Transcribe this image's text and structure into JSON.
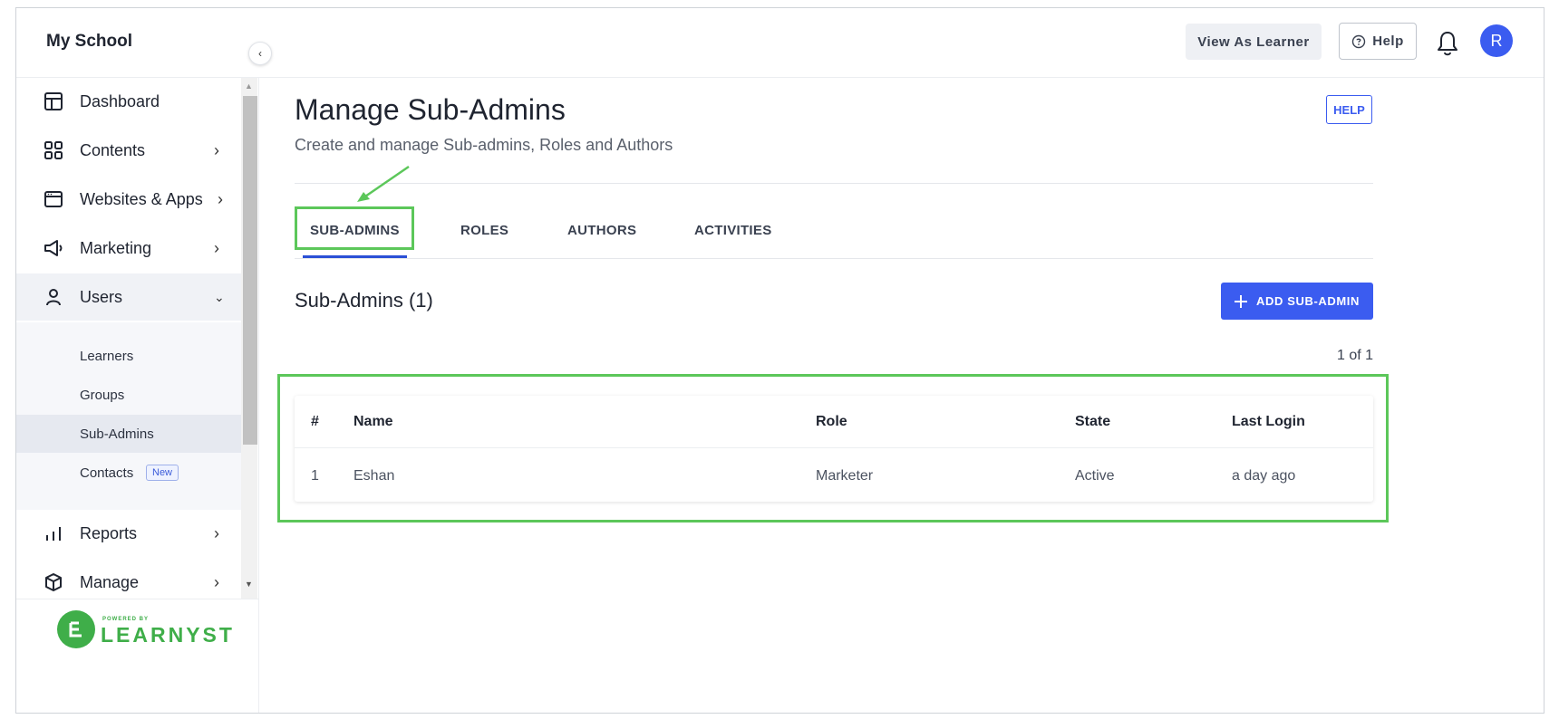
{
  "header": {
    "brand": "My School",
    "view_as_learner": "View As Learner",
    "help": "Help",
    "avatar_initial": "R"
  },
  "sidebar": {
    "items": [
      {
        "label": "Dashboard",
        "icon": "dashboard-icon"
      },
      {
        "label": "Contents",
        "icon": "grid-icon"
      },
      {
        "label": "Websites & Apps",
        "icon": "browser-icon"
      },
      {
        "label": "Marketing",
        "icon": "megaphone-icon"
      },
      {
        "label": "Users",
        "icon": "user-icon"
      },
      {
        "label": "Reports",
        "icon": "bar-chart-icon"
      },
      {
        "label": "Manage",
        "icon": "box-icon"
      }
    ],
    "users_submenu": [
      {
        "label": "Learners"
      },
      {
        "label": "Groups"
      },
      {
        "label": "Sub-Admins"
      },
      {
        "label": "Contacts",
        "badge": "New"
      }
    ],
    "powered_by": "POWERED BY",
    "logo_text": "LEARNYST"
  },
  "main": {
    "title": "Manage Sub-Admins",
    "subtitle": "Create and manage Sub-admins, Roles and Authors",
    "help_button": "HELP",
    "tabs": [
      {
        "label": "SUB-ADMINS",
        "active": true
      },
      {
        "label": "ROLES"
      },
      {
        "label": "AUTHORS"
      },
      {
        "label": "ACTIVITIES"
      }
    ],
    "section_title": "Sub-Admins (1)",
    "add_button": "ADD SUB-ADMIN",
    "pager": "1 of 1",
    "table": {
      "headers": [
        "#",
        "Name",
        "Role",
        "State",
        "Last Login"
      ],
      "rows": [
        [
          "1",
          "Eshan",
          "Marketer",
          "Active",
          "a day ago"
        ]
      ]
    }
  },
  "colors": {
    "accent": "#3b5cf0",
    "highlight": "#5cc75a",
    "brand_green": "#3fae49"
  }
}
